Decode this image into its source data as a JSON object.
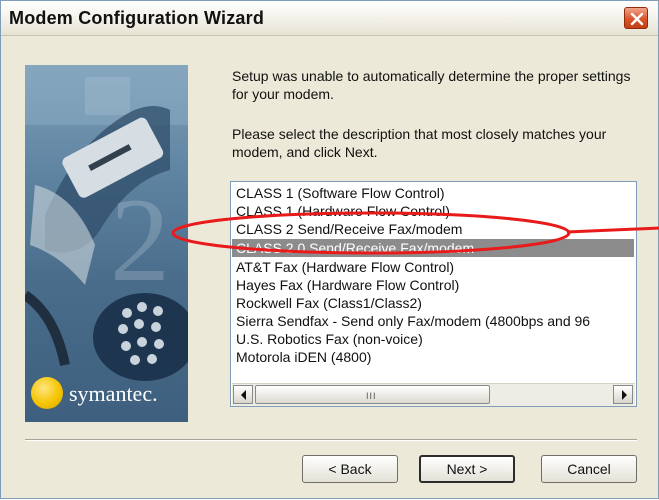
{
  "window": {
    "title": "Modem Configuration Wizard"
  },
  "content": {
    "message1": "Setup was unable to automatically determine the proper settings for your modem.",
    "message2": "Please select the description that most closely matches your modem, and click Next."
  },
  "brand": {
    "logo_text": "symantec."
  },
  "modem_list": {
    "selected_index": 3,
    "items": [
      "CLASS 1 (Software Flow Control)",
      "CLASS 1 (Hardware Flow Control)",
      "CLASS 2 Send/Receive Fax/modem",
      "CLASS 2.0 Send/Receive Fax/modem",
      "AT&T Fax  (Hardware Flow Control)",
      "Hayes Fax  (Hardware Flow Control)",
      "Rockwell Fax (Class1/Class2)",
      "Sierra Sendfax - Send only Fax/modem (4800bps and 96",
      "U.S. Robotics Fax (non-voice)",
      "Motorola iDEN (4800)"
    ]
  },
  "buttons": {
    "back": "< Back",
    "next": "Next >",
    "cancel": "Cancel"
  },
  "icons": {
    "close": "close-icon",
    "scroll_left": "arrow-left-icon",
    "scroll_right": "arrow-right-icon",
    "logo": "symantec-logo-icon"
  },
  "colors": {
    "annotation": "#e81a1a",
    "selection": "#8c8c8c",
    "close_button": "#d9542b"
  }
}
